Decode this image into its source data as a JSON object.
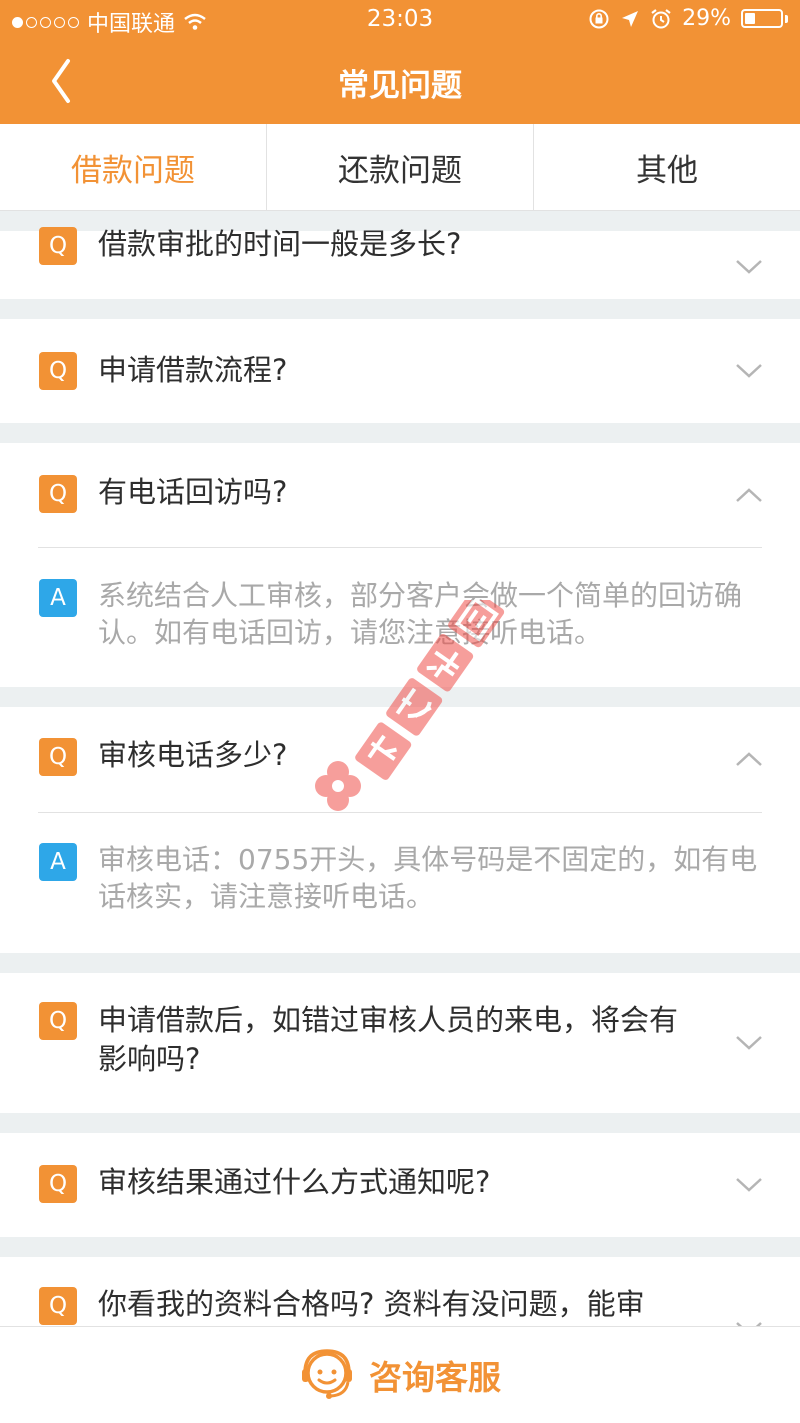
{
  "status_bar": {
    "carrier": "中国联通",
    "time": "23:03",
    "battery": "29%",
    "battery_level": 0.29,
    "signal_bars": 1
  },
  "header": {
    "title": "常见问题"
  },
  "tabs": [
    {
      "label": "借款问题",
      "active": true
    },
    {
      "label": "还款问题",
      "active": false
    },
    {
      "label": "其他",
      "active": false
    }
  ],
  "faq": [
    {
      "q_badge": "Q",
      "question": "借款审批的时间一般是多长?",
      "expanded": false
    },
    {
      "q_badge": "Q",
      "question": "申请借款流程?",
      "expanded": false
    },
    {
      "q_badge": "Q",
      "question": "有电话回访吗?",
      "expanded": true,
      "a_badge": "A",
      "answer": "系统结合人工审核，部分客户会做一个简单的回访确认。如有电话回访，请您注意接听电话。"
    },
    {
      "q_badge": "Q",
      "question": "审核电话多少?",
      "expanded": true,
      "a_badge": "A",
      "answer": "审核电话：0755开头，具体号码是不固定的，如有电话核实，请注意接听电话。"
    },
    {
      "q_badge": "Q",
      "question": "申请借款后，如错过审核人员的来电，将会有影响吗?",
      "expanded": false
    },
    {
      "q_badge": "Q",
      "question": "审核结果通过什么方式通知呢?",
      "expanded": false
    },
    {
      "q_badge": "Q",
      "question": "你看我的资料合格吗? 资料有没问题，能审",
      "expanded": false
    }
  ],
  "footer": {
    "consult_label": "咨询客服"
  },
  "watermark": {
    "text": "卡农社区"
  },
  "colors": {
    "brand_orange": "#f29235",
    "answer_blue": "#2ea7e8",
    "background": "#ecf0f1",
    "watermark_red": "#f0504a"
  }
}
